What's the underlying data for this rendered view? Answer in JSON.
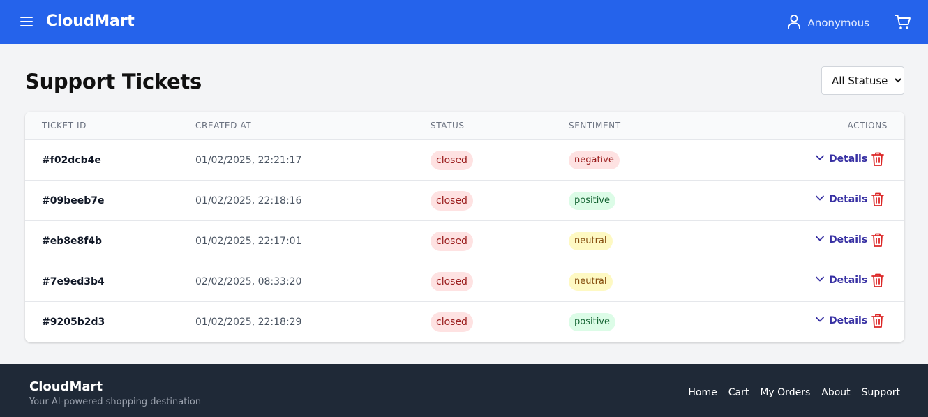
{
  "header": {
    "brand": "CloudMart",
    "user_name": "Anonymous",
    "accent_color": "#2563eb",
    "icons": [
      "menu-icon",
      "user-icon",
      "cart-icon"
    ]
  },
  "main": {
    "title": "Support Tickets",
    "filter": {
      "selected": "All Statuses",
      "options": [
        "All Statuses"
      ]
    },
    "table": {
      "columns": {
        "ticket_id": "TICKET ID",
        "created_at": "CREATED AT",
        "status": "STATUS",
        "sentiment": "SENTIMENT",
        "actions": "ACTIONS"
      },
      "details_label": "Details",
      "rows": [
        {
          "id": "#f02dcb4e",
          "created_at": "01/02/2025, 22:21:17",
          "status": "closed",
          "sentiment": "negative"
        },
        {
          "id": "#09beeb7e",
          "created_at": "01/02/2025, 22:18:16",
          "status": "closed",
          "sentiment": "positive"
        },
        {
          "id": "#eb8e8f4b",
          "created_at": "01/02/2025, 22:17:01",
          "status": "closed",
          "sentiment": "neutral"
        },
        {
          "id": "#7e9ed3b4",
          "created_at": "02/02/2025, 08:33:20",
          "status": "closed",
          "sentiment": "neutral"
        },
        {
          "id": "#9205b2d3",
          "created_at": "01/02/2025, 22:18:29",
          "status": "closed",
          "sentiment": "positive"
        }
      ]
    }
  },
  "footer": {
    "brand": "CloudMart",
    "tagline": "Your AI-powered shopping destination",
    "links": [
      "Home",
      "Cart",
      "My Orders",
      "About",
      "Support"
    ]
  },
  "colors": {
    "status_closed_bg": "#fee2e2",
    "sentiment_negative_bg": "#fee2e2",
    "sentiment_positive_bg": "#dcfce7",
    "sentiment_neutral_bg": "#fef9c3",
    "footer_bg": "#1f2937"
  }
}
